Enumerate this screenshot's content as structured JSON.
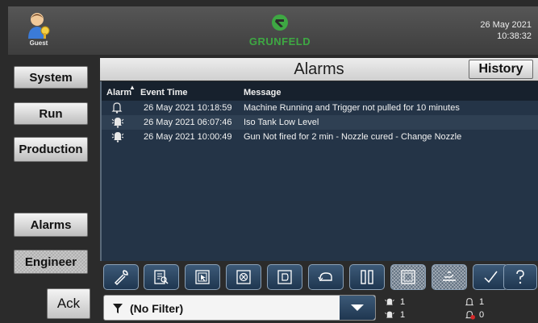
{
  "header": {
    "user_label": "Guest",
    "logo_text": "GRUNFELD",
    "date": "26 May 2021",
    "time": "10:38:32"
  },
  "nav": {
    "system": "System",
    "run": "Run",
    "production": "Production",
    "alarms": "Alarms",
    "engineer": "Engineer",
    "ack": "Ack"
  },
  "main": {
    "title": "Alarms",
    "history_label": "History",
    "columns": {
      "alarm": "Alarm",
      "event_time": "Event Time",
      "message": "Message"
    },
    "rows": [
      {
        "icon": "bell-outline-icon",
        "time": "26 May 2021 10:18:59",
        "message": "Machine Running and Trigger not pulled for 10 minutes"
      },
      {
        "icon": "bell-active-icon",
        "time": "26 May 2021 06:07:46",
        "message": "Iso Tank Low Level"
      },
      {
        "icon": "bell-active-icon",
        "time": "26 May 2021 10:00:49",
        "message": "Gun Not fired for 2 min - Nozzle cured - Change Nozzle"
      }
    ]
  },
  "toolbar": {
    "tools": [
      "wrench-icon",
      "view-details-icon",
      "select-icon",
      "clear-icon",
      "focus-icon",
      "undo-icon",
      "pause-icon",
      "hatched-select-icon",
      "hatched-shelve-icon",
      "check-icon",
      "help-icon"
    ]
  },
  "filter": {
    "label": "(No Filter)"
  },
  "counts": {
    "active_unacked": "1",
    "active_acked": "1",
    "inactive_unacked": "1",
    "inactive_error": "0"
  },
  "colors": {
    "background": "#2b2b2b",
    "grid_background": "#243447",
    "grid_header": "#17212d",
    "logo_green": "#3ea843",
    "toolbar_blue": "#2c4866"
  }
}
